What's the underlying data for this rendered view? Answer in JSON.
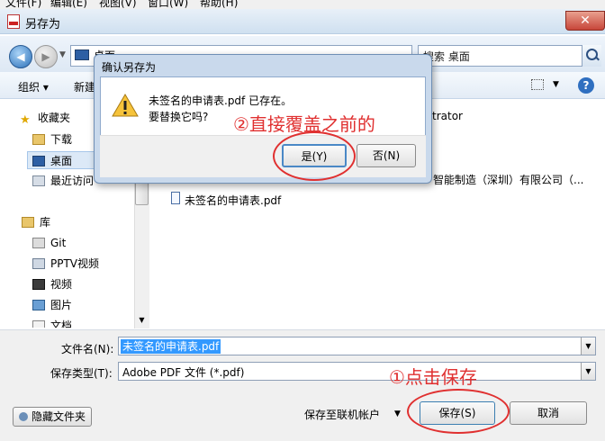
{
  "menubar": {
    "items": [
      "文件(F)",
      "编辑(E)",
      "视图(V)",
      "窗口(W)",
      "帮助(H)"
    ]
  },
  "window": {
    "title": "另存为",
    "close": "✕"
  },
  "nav": {
    "address": "桌面",
    "search_placeholder": "搜索 桌面"
  },
  "toolbar": {
    "organize": "组织 ▾",
    "new_folder": "新建"
  },
  "sidebar": {
    "favorites": "收藏夹",
    "downloads": "下载",
    "desktop": "桌面",
    "recent": "最近访问",
    "libraries": "库",
    "git": "Git",
    "pptv": "PPTV视频",
    "videos": "视频",
    "pictures": "图片",
    "documents": "文档"
  },
  "files": {
    "item_admin_tail": "trator",
    "item_company": "智能制造（深圳）有限公司（...",
    "item_pdf": "未签名的申请表.pdf"
  },
  "form": {
    "filename_label": "文件名(N):",
    "filename_value": "未签名的申请表.pdf",
    "filetype_label": "保存类型(T):",
    "filetype_value": "Adobe PDF 文件 (*.pdf)"
  },
  "footer": {
    "hide_folders": "隐藏文件夹",
    "save_online": "保存至联机帐户",
    "save": "保存(S)",
    "cancel": "取消"
  },
  "confirm": {
    "title": "确认另存为",
    "message_line1": "未签名的申请表.pdf 已存在。",
    "message_line2": "要替换它吗?",
    "yes": "是(Y)",
    "no": "否(N)"
  },
  "annotations": {
    "step2": "②直接覆盖之前的",
    "step1": "①点击保存"
  },
  "colors": {
    "annotation": "#e03030",
    "selection": "#3399ff"
  }
}
